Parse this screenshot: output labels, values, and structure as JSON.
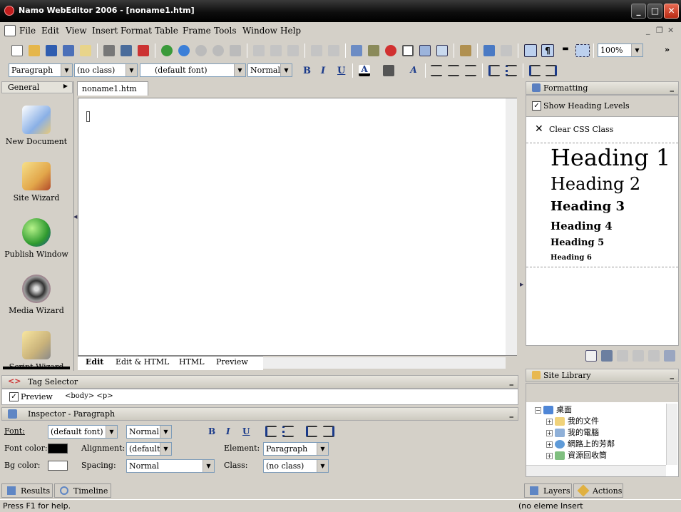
{
  "window": {
    "title": "Namo WebEditor 2006 - [noname1.htm]"
  },
  "menu": [
    "File",
    "Edit",
    "View",
    "Insert",
    "Format",
    "Table",
    "Frame",
    "Tools",
    "Window",
    "Help"
  ],
  "toolbar": {
    "zoom": "100%"
  },
  "format_bar": {
    "paragraph": "Paragraph",
    "class": "(no class)",
    "font": "(default font)",
    "size": "Normal",
    "bold": "B",
    "italic": "I",
    "underline": "U"
  },
  "left_panel": {
    "header": "General",
    "items": [
      "New Document",
      "Site Wizard",
      "Publish Window",
      "Media Wizard",
      "Script Wizard"
    ]
  },
  "document": {
    "tab": "noname1.htm",
    "view_tabs": [
      "Edit",
      "Edit & HTML",
      "HTML",
      "Preview"
    ]
  },
  "formatting": {
    "title": "Formatting",
    "show_heading_levels": "Show Heading Levels",
    "clear_css": "Clear CSS Class",
    "headings": [
      "Heading 1",
      "Heading 2",
      "Heading 3",
      "Heading 4",
      "Heading 5",
      "Heading 6"
    ]
  },
  "site_library": {
    "title": "Site Library",
    "tree": [
      "桌面",
      "我的文件",
      "我的電腦",
      "網路上的芳鄰",
      "資源回收筒"
    ]
  },
  "tag_selector": {
    "title": "Tag Selector",
    "preview": "Preview",
    "tags": "<body> <p>"
  },
  "inspector": {
    "title": "Inspector - Paragraph",
    "font_label": "Font:",
    "font_value": "(default font)",
    "size_value": "Normal",
    "font_color_label": "Font color:",
    "alignment_label": "Alignment:",
    "alignment_value": "(default)",
    "element_label": "Element:",
    "element_value": "Paragraph",
    "bg_color_label": "Bg color:",
    "spacing_label": "Spacing:",
    "spacing_value": "Normal",
    "class_label": "Class:",
    "class_value": "(no class)",
    "bold": "B",
    "italic": "I",
    "underline": "U"
  },
  "bottom_tabs": [
    "Results",
    "Timeline"
  ],
  "right_bottom_tabs": [
    "Layers",
    "Actions"
  ],
  "status": {
    "left": "Press F1 for help.",
    "right": "(no eleme Insert"
  },
  "colors": {
    "font_color": "#000000",
    "bg_color": "#ffffff",
    "titlebar": "#1a1a1a"
  }
}
